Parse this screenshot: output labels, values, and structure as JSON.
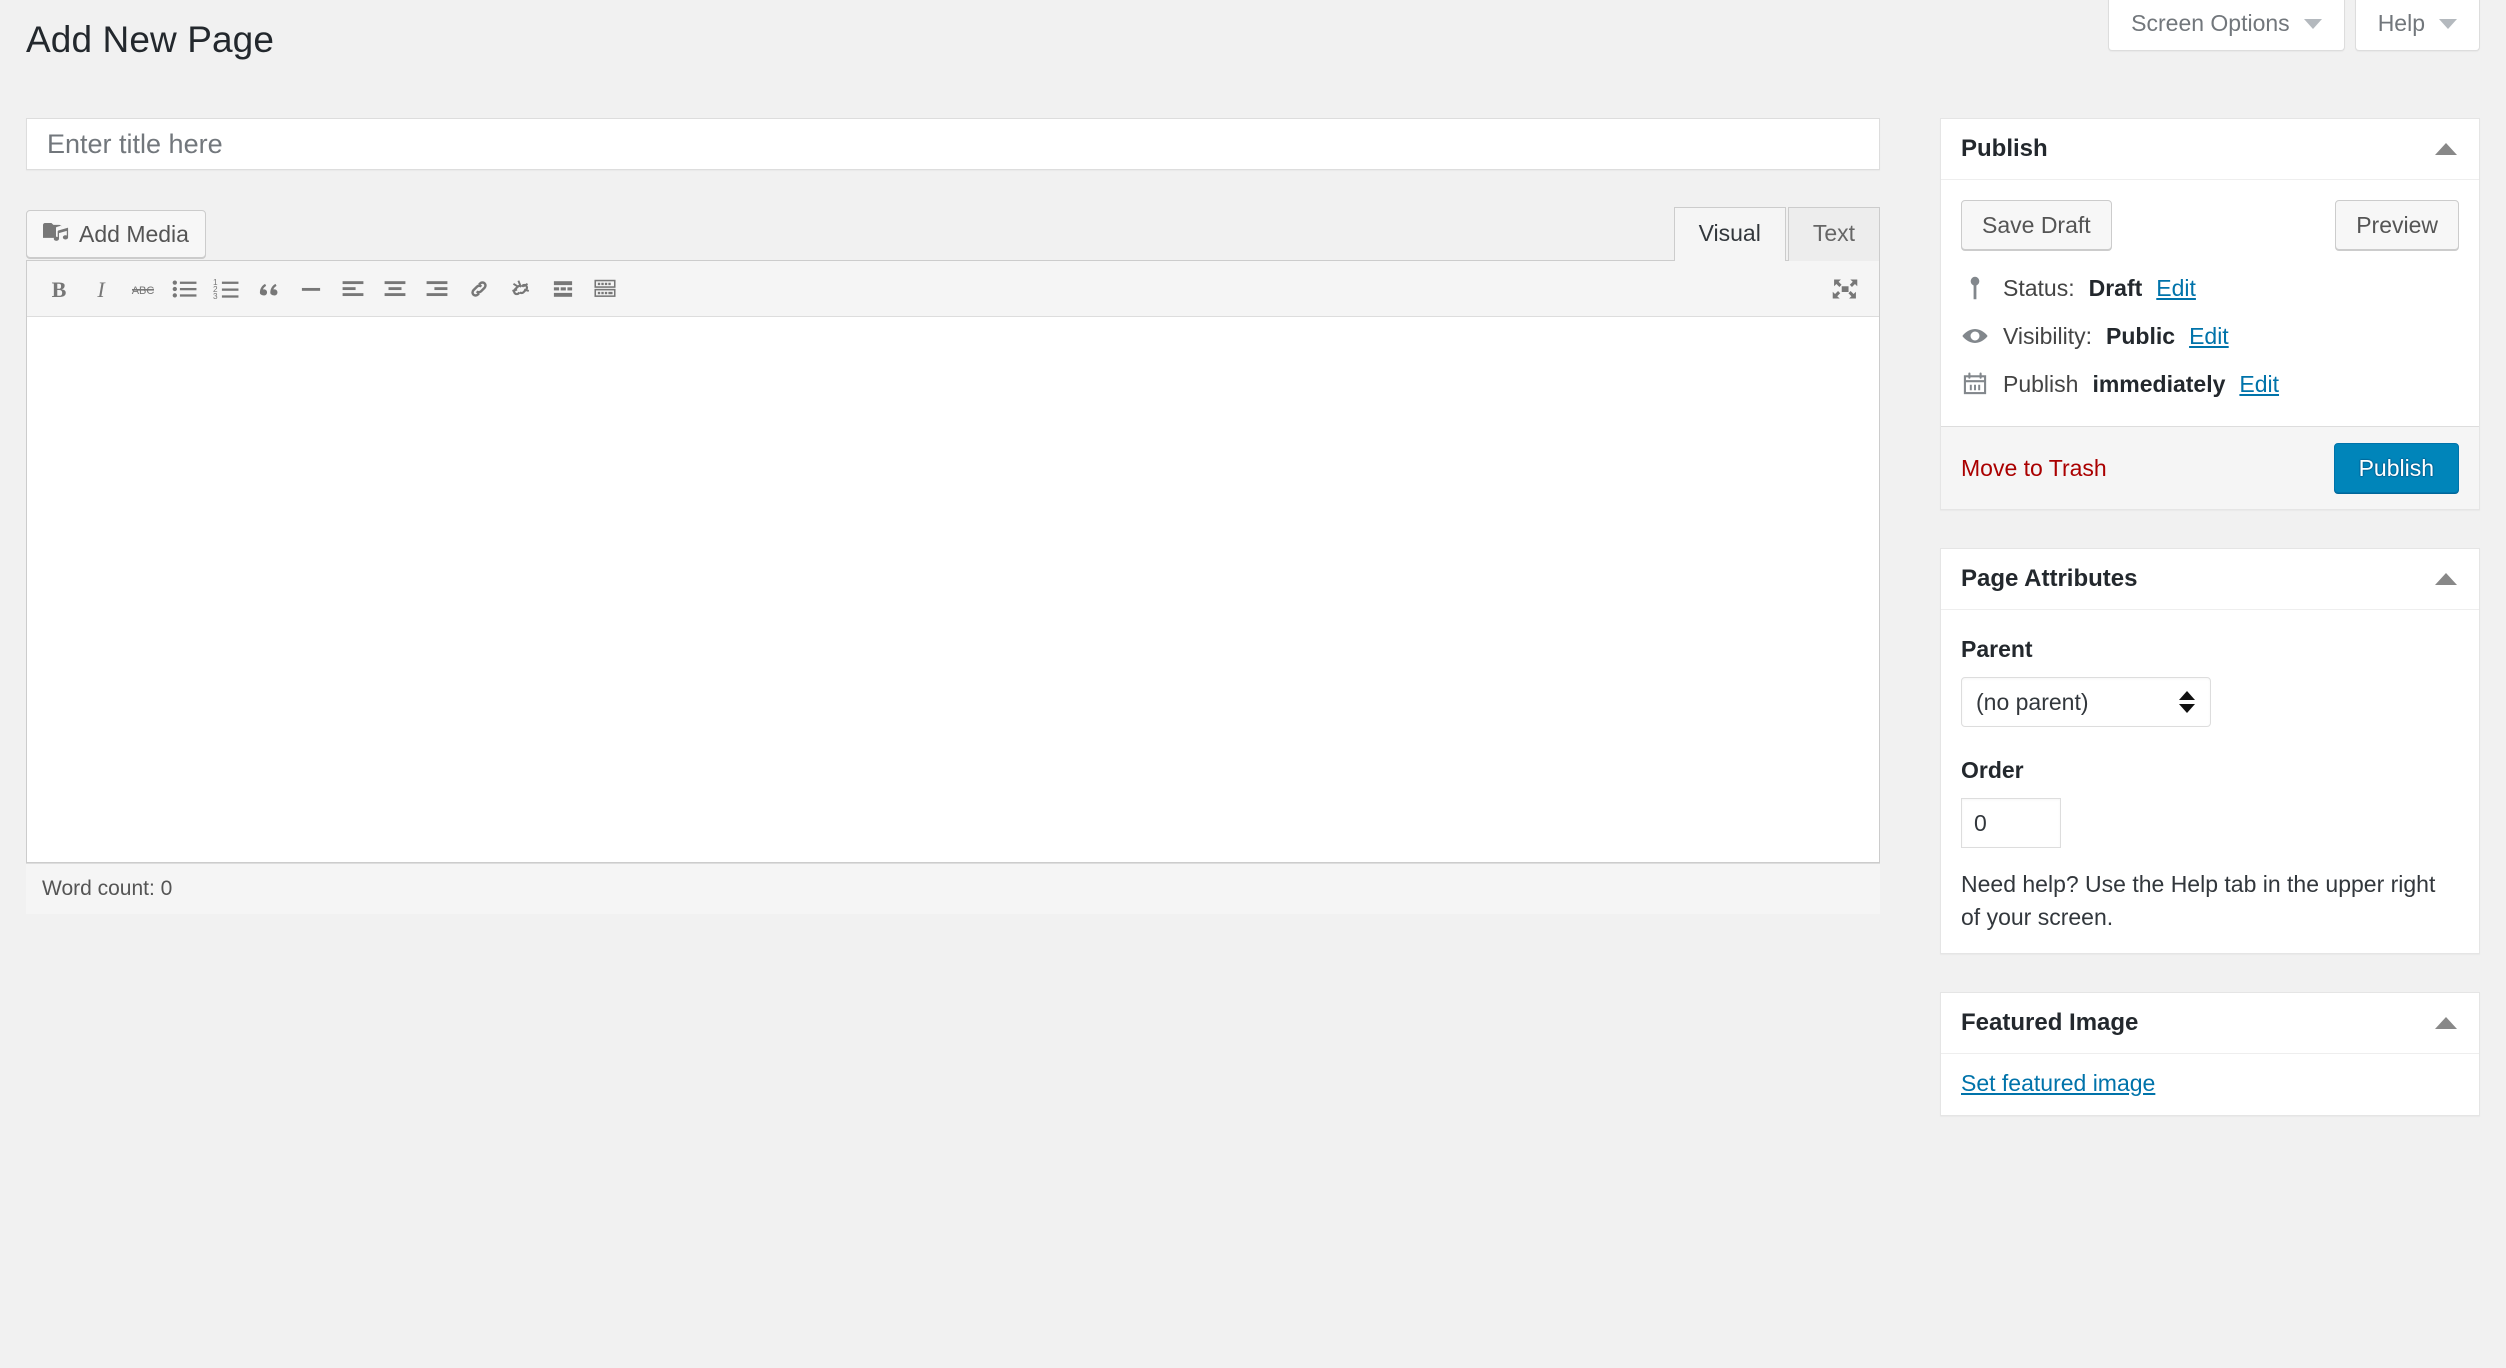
{
  "screen_meta": {
    "screen_options_label": "Screen Options",
    "help_label": "Help"
  },
  "page_title": "Add New Page",
  "title_field": {
    "placeholder": "Enter title here",
    "value": ""
  },
  "editor": {
    "add_media_label": "Add Media",
    "tabs": [
      {
        "label": "Visual",
        "active": true
      },
      {
        "label": "Text",
        "active": false
      }
    ],
    "toolbar": [
      {
        "name": "bold",
        "title": "Bold"
      },
      {
        "name": "italic",
        "title": "Italic"
      },
      {
        "name": "strikethrough",
        "title": "Strikethrough"
      },
      {
        "name": "bulleted-list",
        "title": "Bulleted list"
      },
      {
        "name": "numbered-list",
        "title": "Numbered list"
      },
      {
        "name": "blockquote",
        "title": "Blockquote"
      },
      {
        "name": "horizontal-line",
        "title": "Horizontal line"
      },
      {
        "name": "align-left",
        "title": "Align left"
      },
      {
        "name": "align-center",
        "title": "Align center"
      },
      {
        "name": "align-right",
        "title": "Align right"
      },
      {
        "name": "insert-link",
        "title": "Insert/edit link"
      },
      {
        "name": "remove-link",
        "title": "Remove link"
      },
      {
        "name": "read-more",
        "title": "Insert Read More tag"
      },
      {
        "name": "toolbar-toggle",
        "title": "Toolbar Toggle"
      }
    ],
    "fullscreen_title": "Distraction-free writing mode",
    "content": "",
    "word_count_label": "Word count: 0"
  },
  "publish_box": {
    "title": "Publish",
    "save_draft_label": "Save Draft",
    "preview_label": "Preview",
    "status": {
      "label": "Status:",
      "value": "Draft",
      "edit": "Edit"
    },
    "visibility": {
      "label": "Visibility:",
      "value": "Public",
      "edit": "Edit"
    },
    "schedule": {
      "label": "Publish",
      "value": "immediately",
      "edit": "Edit"
    },
    "trash_label": "Move to Trash",
    "publish_label": "Publish"
  },
  "page_attributes_box": {
    "title": "Page Attributes",
    "parent_label": "Parent",
    "parent_value": "(no parent)",
    "parent_options": [
      "(no parent)"
    ],
    "order_label": "Order",
    "order_value": "0",
    "help_text": "Need help? Use the Help tab in the upper right of your screen."
  },
  "featured_image_box": {
    "title": "Featured Image",
    "set_link_label": "Set featured image"
  },
  "colors": {
    "primary": "#0085ba",
    "link": "#0073aa",
    "danger": "#a00",
    "page_bg": "#f1f1f1"
  }
}
